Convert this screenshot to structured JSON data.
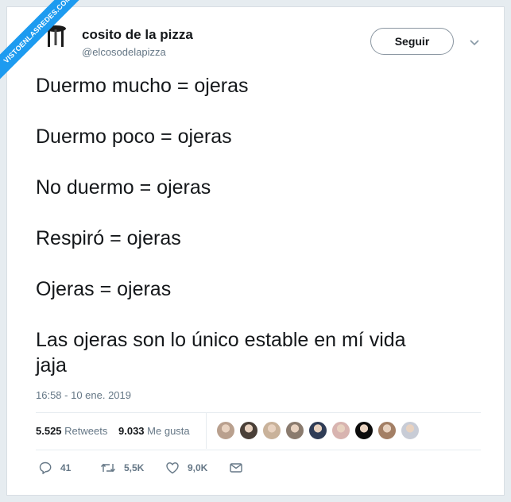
{
  "watermark": "VISTOENLASREDES.COM",
  "author": {
    "name": "cosito de la pizza",
    "handle": "@elcosodelapizza",
    "avatar_icon": "pizza-saver-icon"
  },
  "follow_label": "Seguir",
  "tweet_lines": [
    "Duermo mucho = ojeras",
    "Duermo poco = ojeras",
    "No duermo = ojeras",
    "Respiró = ojeras",
    "Ojeras = ojeras",
    "Las ojeras son lo único estable en mí vida",
    "jaja"
  ],
  "timestamp": "16:58 - 10 ene. 2019",
  "stats": {
    "retweets_count": "5.525",
    "retweets_label": "Retweets",
    "likes_count": "9.033",
    "likes_label": "Me gusta"
  },
  "liker_avatar_colors": [
    "#b9a08e",
    "#4a4038",
    "#c9b29a",
    "#8a7b6e",
    "#2f3c56",
    "#d8b4b0",
    "#0c0c0c",
    "#a37f65",
    "#c8ccd6"
  ],
  "actions": {
    "reply_count": "41",
    "retweet_count": "5,5K",
    "like_count": "9,0K"
  },
  "colors": {
    "text": "#14171a",
    "muted": "#657786",
    "accent": "#1d9bf0"
  }
}
